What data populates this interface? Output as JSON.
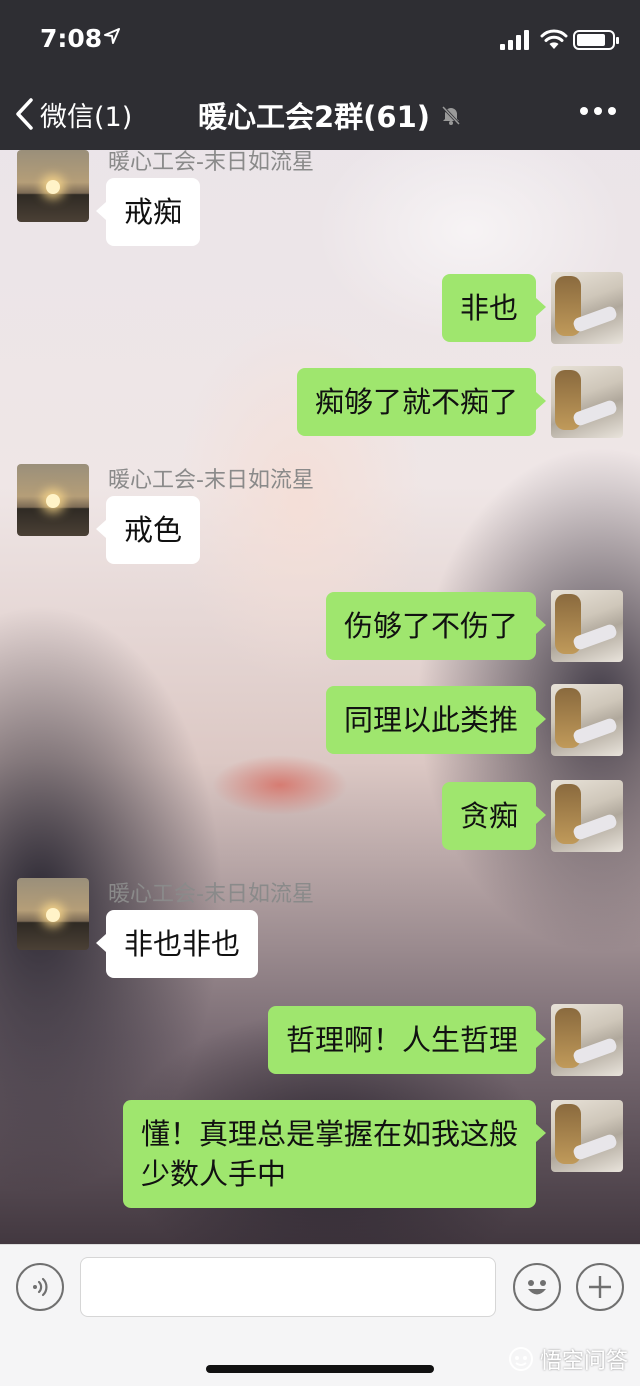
{
  "status_bar": {
    "time": "7:08"
  },
  "nav": {
    "back_label": "微信(1)",
    "title": "暖心工会2群(61)"
  },
  "chat": {
    "sender_name": "暖心工会-末日如流星",
    "messages": [
      {
        "dir": "in",
        "text": "戒痴"
      },
      {
        "dir": "out",
        "text": "非也"
      },
      {
        "dir": "out",
        "text": "痴够了就不痴了"
      },
      {
        "dir": "in",
        "text": "戒色"
      },
      {
        "dir": "out",
        "text": "伤够了不伤了"
      },
      {
        "dir": "out",
        "text": "同理以此类推"
      },
      {
        "dir": "out",
        "text": "贪痴"
      },
      {
        "dir": "in",
        "text": "非也非也"
      },
      {
        "dir": "out",
        "text": "哲理啊！人生哲理"
      },
      {
        "dir": "out",
        "text_line1": "懂！真理总是掌握在如我这般",
        "text_line2": "少数人手中"
      }
    ]
  },
  "input_bar": {
    "message_input": ""
  },
  "watermark": {
    "text": "悟空问答"
  },
  "colors": {
    "nav_bg": "#2e2e33",
    "outgoing_bubble": "#9fe66e",
    "incoming_bubble": "#ffffff",
    "input_bar_bg": "#f5f5f6"
  },
  "icons": [
    "location-arrow-icon",
    "signal-icon",
    "wifi-icon",
    "battery-icon",
    "chevron-left-icon",
    "mute-bell-icon",
    "more-icon",
    "voice-icon",
    "emoji-icon",
    "plus-icon"
  ]
}
